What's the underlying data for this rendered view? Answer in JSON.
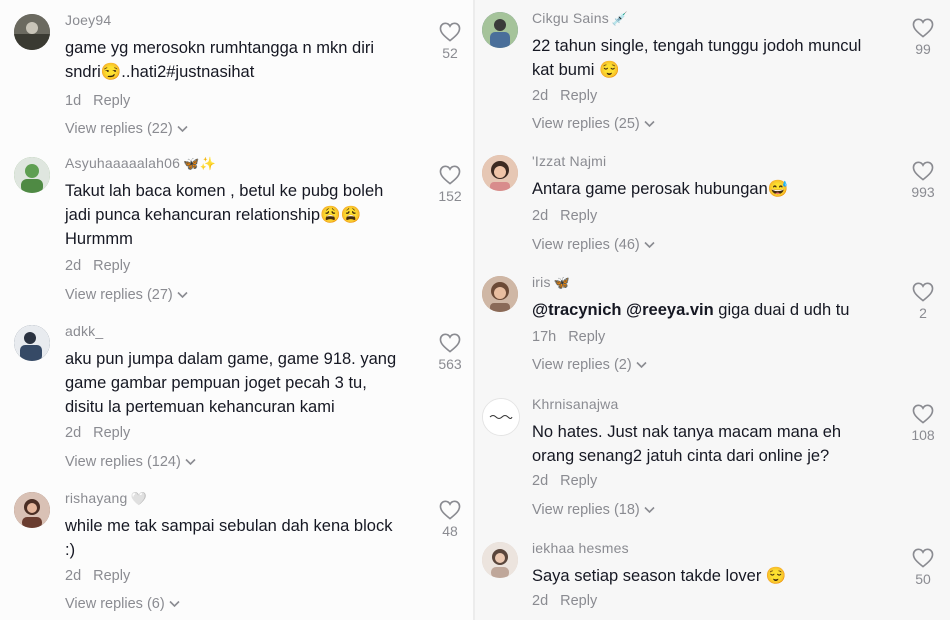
{
  "left_comments": [
    {
      "username": "Joey94",
      "username_emoji": "",
      "text": "game yg merosokn rumhtangga n mkn diri sndri😏..hati2#justnasihat",
      "time": "1d",
      "reply_label": "Reply",
      "view_replies": "View replies (22)",
      "likes": "52",
      "avatar_color": "#4c4a44"
    },
    {
      "username": "Asyuhaaaaalah06",
      "username_emoji": "🦋✨",
      "text": "Takut lah baca komen , betul ke pubg boleh jadi punca kehancuran relationship😩😩 Hurmmm",
      "time": "2d",
      "reply_label": "Reply",
      "view_replies": "View replies (27)",
      "likes": "152",
      "avatar_color": "#6aa05a"
    },
    {
      "username": "adkk_",
      "username_emoji": "",
      "text": "aku pun jumpa dalam game, game 918. yang game gambar pempuan joget pecah 3 tu, disitu la pertemuan kehancuran kami",
      "time": "2d",
      "reply_label": "Reply",
      "view_replies": "View replies (124)",
      "likes": "563",
      "avatar_color": "#2e3d52"
    },
    {
      "username": "rishayang",
      "username_emoji": "🤍",
      "text": "while me tak sampai sebulan dah kena block :)",
      "time": "2d",
      "reply_label": "Reply",
      "view_replies": "View replies (6)",
      "likes": "48",
      "avatar_color": "#7a4f40"
    }
  ],
  "right_comments": [
    {
      "username": "Cikgu Sains",
      "username_emoji": "💉",
      "text": "22 tahun single, tengah tunggu jodoh muncul kat bumi 😌",
      "time": "2d",
      "reply_label": "Reply",
      "view_replies": "View replies (25)",
      "likes": "99",
      "avatar_color": "#4e6e8a"
    },
    {
      "username": "'Izzat Najmi",
      "username_emoji": "",
      "text": "Antara game perosak hubungan😅",
      "time": "2d",
      "reply_label": "Reply",
      "view_replies": "View replies (46)",
      "likes": "993",
      "avatar_color": "#c9a08a"
    },
    {
      "username": "iris",
      "username_emoji": "🦋",
      "mention1": "@tracynich",
      "mention2": "@reeya.vin",
      "text_rest": " giga duai d udh tu",
      "time": "17h",
      "reply_label": "Reply",
      "view_replies": "View replies (2)",
      "likes": "2",
      "avatar_color": "#b89078"
    },
    {
      "username": "Khrnisanajwa",
      "username_emoji": "",
      "text": "No hates. Just nak tanya macam mana eh orang senang2 jatuh cinta dari online je?",
      "time": "2d",
      "reply_label": "Reply",
      "view_replies": "View replies (18)",
      "likes": "108",
      "avatar_color": "#ffffff"
    },
    {
      "username": "iekhaa hesmes",
      "username_emoji": "",
      "text": "Saya setiap season takde lover 😌",
      "time": "2d",
      "reply_label": "Reply",
      "likes": "50",
      "avatar_color": "#d8c8c0"
    }
  ]
}
